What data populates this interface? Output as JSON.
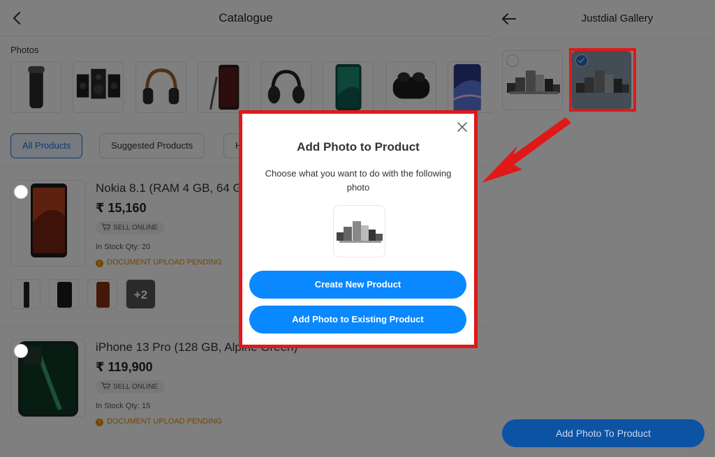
{
  "catalogue": {
    "title": "Catalogue",
    "photos_label": "Photos",
    "photo_icons": [
      "thermos-photo",
      "speaker-system-photo",
      "headphones-photo",
      "smartphone-stylus-photo",
      "headphones-dark-photo",
      "smartphone-photo",
      "earbuds-photo",
      "smartphone-wallpaper-photo"
    ],
    "filters": [
      {
        "label": "All Products",
        "active": true
      },
      {
        "label": "Suggested Products",
        "active": false
      },
      {
        "label": "H",
        "active": false
      }
    ],
    "products": [
      {
        "name": "Nokia 8.1 (RAM 4 GB, 64 G",
        "price": "₹ 15,160",
        "sell_online": "SELL ONLINE",
        "stock": "In Stock Qty: 20",
        "pending": "DOCUMENT UPLOAD PENDING",
        "more_photos": "+2"
      },
      {
        "name": "iPhone 13 Pro (128 GB, Alpine Green)",
        "price": "₹ 119,900",
        "sell_online": "SELL ONLINE",
        "stock": "In Stock Qty: 15",
        "pending": "DOCUMENT UPLOAD PENDING"
      }
    ]
  },
  "gallery": {
    "title": "Justdial Gallery",
    "images": [
      {
        "icon": "electronics-appliances-photo",
        "selected": false
      },
      {
        "icon": "electronics-appliances-photo",
        "selected": true
      }
    ],
    "button_label": "Add Photo To Product"
  },
  "modal": {
    "title": "Add Photo to Product",
    "description": "Choose what you want to do with the following photo",
    "create_label": "Create New Product",
    "add_existing_label": "Add Photo to Existing Product"
  },
  "colors": {
    "accent": "#0a88ff",
    "highlight_red": "#e01818",
    "warning": "#e58a00"
  }
}
